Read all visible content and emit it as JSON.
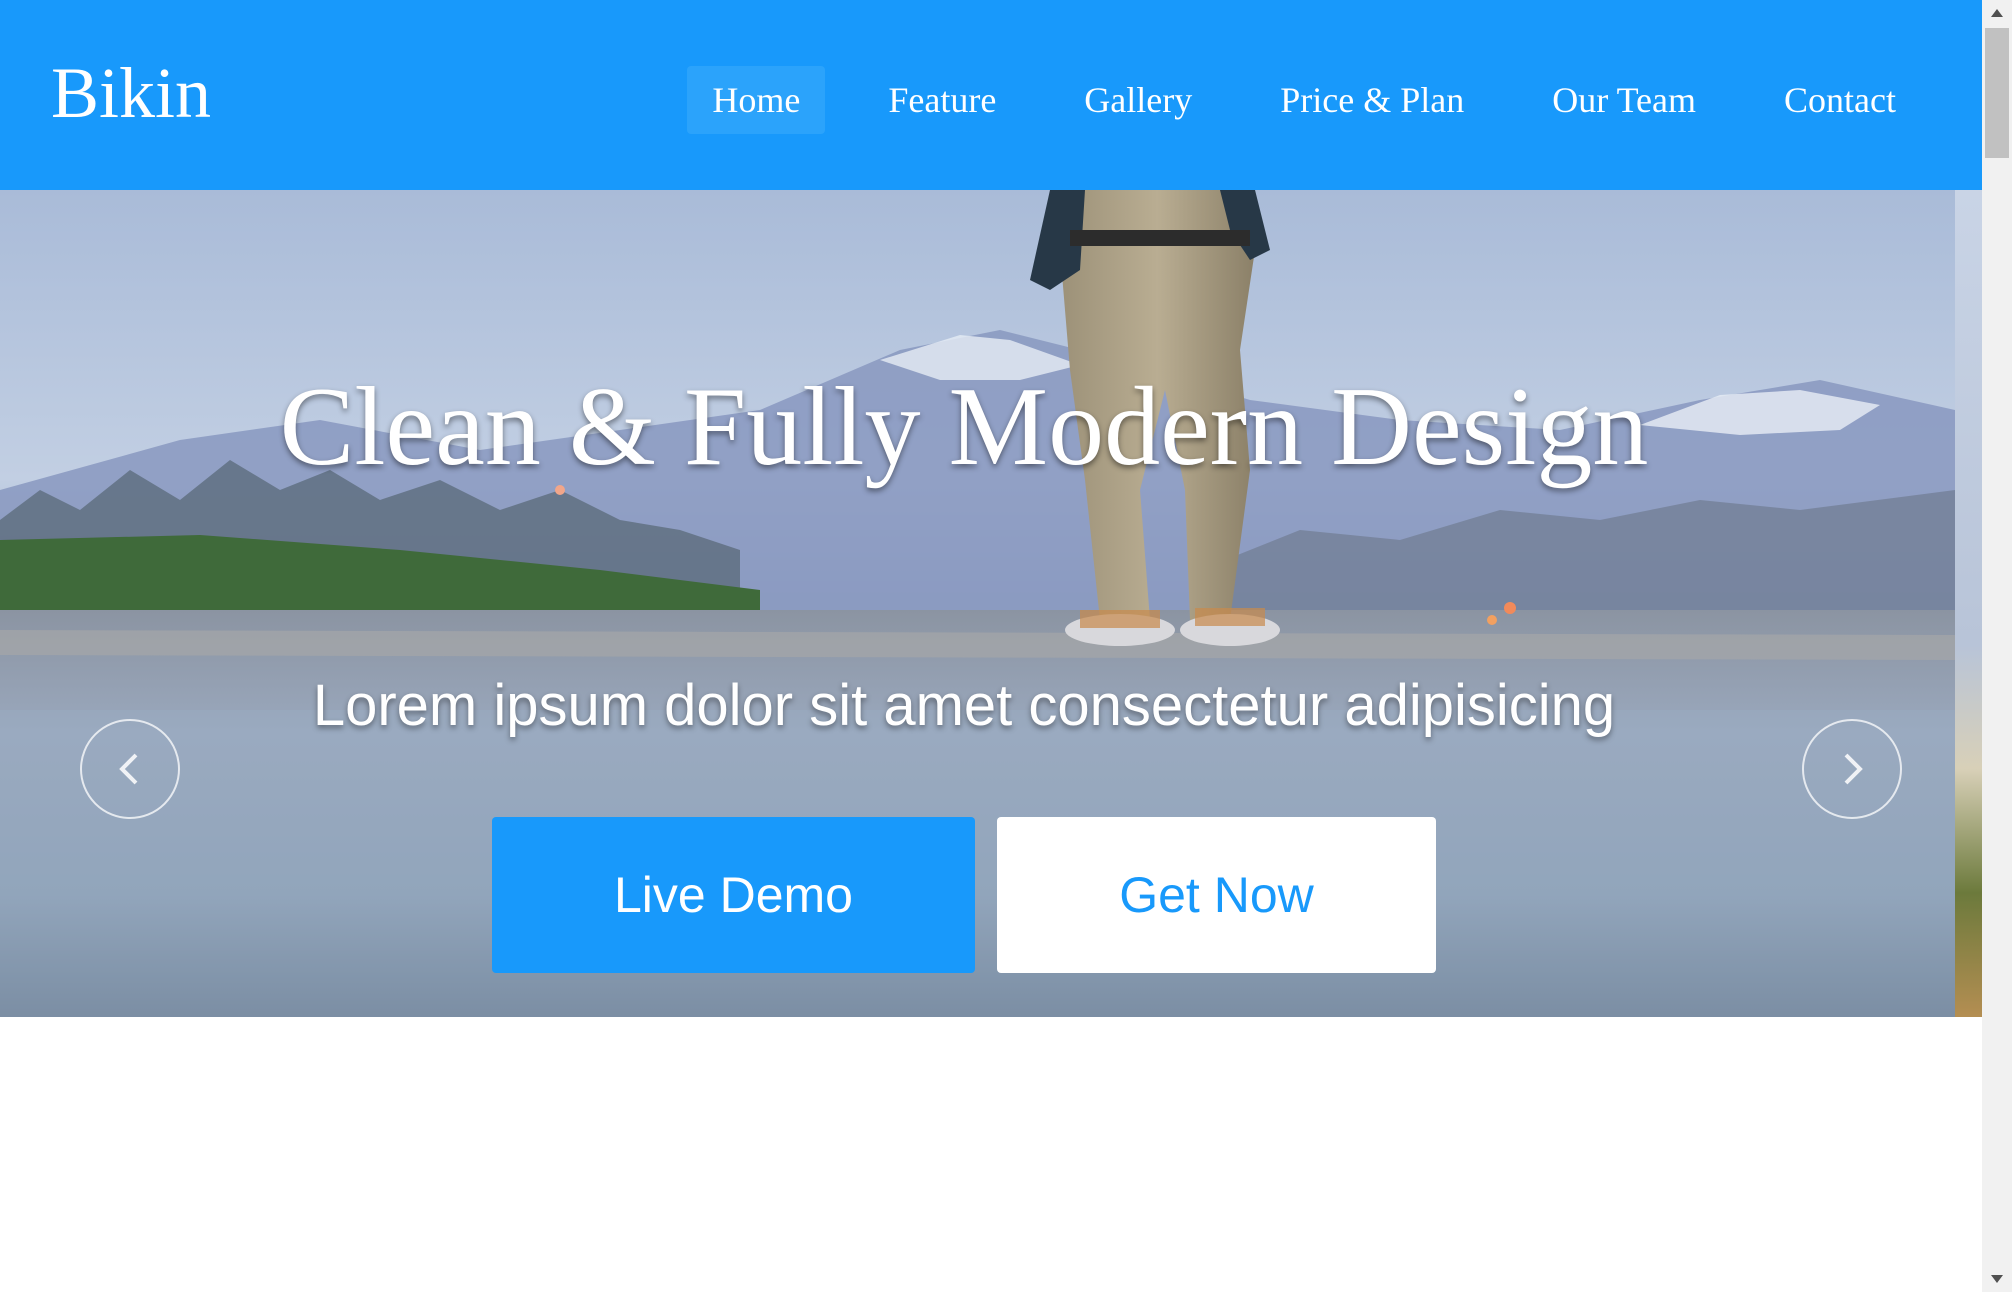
{
  "header": {
    "logo": "Bikin",
    "nav": [
      {
        "label": "Home",
        "active": true
      },
      {
        "label": "Feature",
        "active": false
      },
      {
        "label": "Gallery",
        "active": false
      },
      {
        "label": "Price & Plan",
        "active": false
      },
      {
        "label": "Our Team",
        "active": false
      },
      {
        "label": "Contact",
        "active": false
      }
    ]
  },
  "hero": {
    "title": "Clean & Fully Modern Design",
    "subtitle": "Lorem ipsum dolor sit amet consectetur adipisicing",
    "primary_button": "Live Demo",
    "secondary_button": "Get Now",
    "prev_icon": "chevron-left-icon",
    "next_icon": "chevron-right-icon"
  },
  "colors": {
    "brand": "#1899fb",
    "nav_active": "#2ba3fb",
    "text_light": "#ffffff"
  }
}
